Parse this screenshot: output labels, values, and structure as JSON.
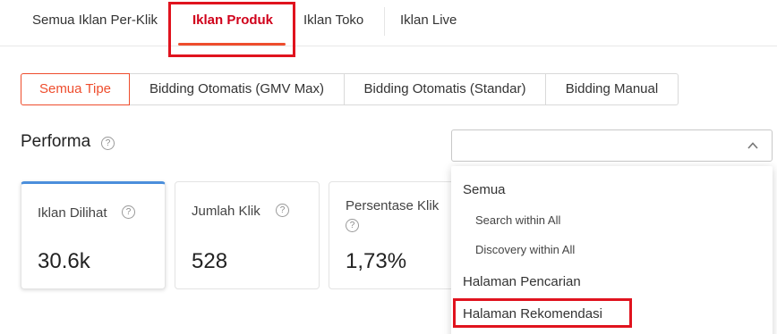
{
  "tabs": [
    {
      "label": "Semua Iklan Per-Klik"
    },
    {
      "label": "Iklan Produk",
      "active": true
    },
    {
      "label": "Iklan Toko"
    },
    {
      "label": "Iklan Live"
    }
  ],
  "segments": [
    {
      "label": "Semua Tipe",
      "active": true
    },
    {
      "label": "Bidding Otomatis (GMV Max)"
    },
    {
      "label": "Bidding Otomatis (Standar)"
    },
    {
      "label": "Bidding Manual"
    }
  ],
  "performa": {
    "title": "Performa",
    "help_icon": "question-circle-icon",
    "select_value": ""
  },
  "metrics": [
    {
      "label": "Iklan Dilihat",
      "value": "30.6k"
    },
    {
      "label": "Jumlah Klik",
      "value": "528"
    },
    {
      "label": "Persentase Klik",
      "value": "1,73%"
    }
  ],
  "dropdown": {
    "items": [
      {
        "label": "Semua",
        "type": "group"
      },
      {
        "label": "Search within All",
        "type": "sub"
      },
      {
        "label": "Discovery within All",
        "type": "sub"
      },
      {
        "label": "Halaman Pencarian",
        "type": "group"
      },
      {
        "label": "Halaman Rekomendasi",
        "type": "group"
      }
    ]
  },
  "colors": {
    "accent": "#ee4d2d",
    "active_tab": "#d0011b",
    "highlight_box": "#e0131e",
    "card_active_top": "#4b8fdc"
  }
}
